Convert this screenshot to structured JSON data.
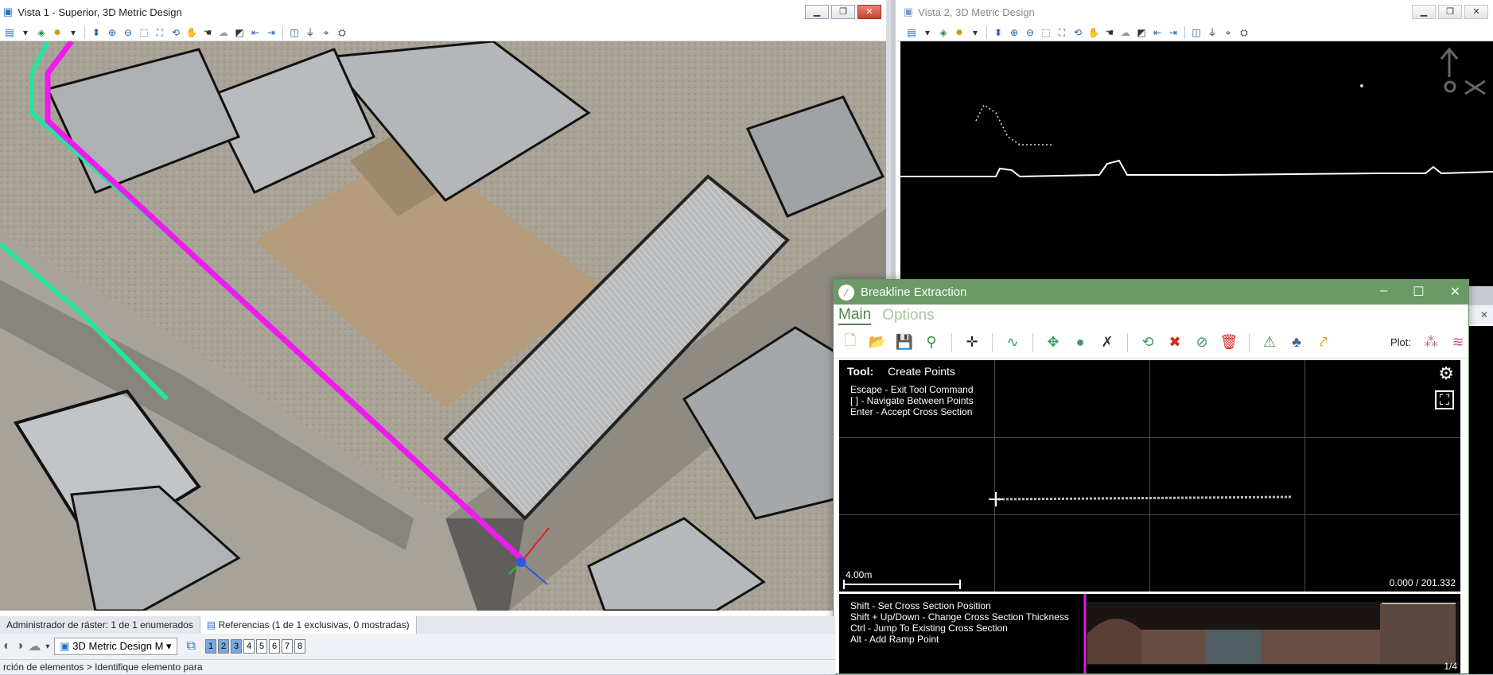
{
  "view1": {
    "title": "Vista 1 - Superior, 3D Metric Design"
  },
  "view2": {
    "title": "Vista 2, 3D Metric Design"
  },
  "breakline": {
    "title": "Breakline Extraction",
    "tabs": [
      "Main",
      "Options"
    ],
    "plot_label": "Plot:",
    "tool_label": "Tool:",
    "tool_value": "Create Points",
    "help_top": [
      "Escape - Exit Tool Command",
      "[ ] - Navigate Between Points",
      "Enter - Accept Cross Section"
    ],
    "scale_label": "4.00m",
    "station": "0.000 / 201.332",
    "help_bottom": [
      "Shift - Set Cross Section Position",
      "Shift + Up/Down - Change Cross Section Thickness",
      "Ctrl - Jump To Existing Cross Section",
      "Alt - Add Ramp Point"
    ],
    "page": "1/4",
    "accent": "#6c9a66"
  },
  "panels": {
    "raster": "Administrador de ráster: 1 de 1 enumerados",
    "references": "Referencias (1 de 1 exclusivas, 0 mostradas)"
  },
  "bottom": {
    "model": "3D Metric Design M",
    "views": [
      "1",
      "2",
      "3",
      "4",
      "5",
      "6",
      "7",
      "8"
    ],
    "status": "rción de elementos > Identifique elemento para"
  }
}
